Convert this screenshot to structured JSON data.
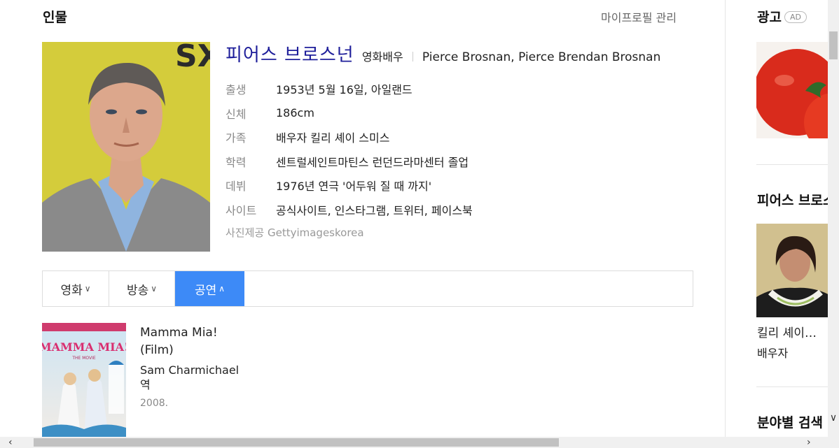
{
  "section": {
    "title": "인물",
    "my_profile_link": "마이프로필 관리"
  },
  "profile": {
    "name": "피어스 브로스넌",
    "job": "영화배우",
    "english_name": "Pierce Brosnan, Pierce Brendan Brosnan",
    "info": [
      {
        "label": "출생",
        "value": "1953년 5월 16일, 아일랜드"
      },
      {
        "label": "신체",
        "value": "186cm"
      },
      {
        "label": "가족",
        "value": "배우자 킬리 셰이 스미스"
      },
      {
        "label": "학력",
        "value": "센트럴세인트마틴스 런던드라마센터 졸업"
      },
      {
        "label": "데뷔",
        "value": "1976년 연극 '어두워 질 때 까지'"
      },
      {
        "label": "사이트",
        "value": "공식사이트, 인스타그램, 트위터, 페이스북"
      }
    ],
    "photo_credit": "사진제공 Gettyimageskorea",
    "photo_backdrop_text": "SX SW"
  },
  "tabs": [
    {
      "label": "영화",
      "chevron": "∨",
      "active": false
    },
    {
      "label": "방송",
      "chevron": "∨",
      "active": false
    },
    {
      "label": "공연",
      "chevron": "∧",
      "active": true
    }
  ],
  "works": [
    {
      "title": "Mamma Mia! (Film)",
      "role": "Sam Charmichael 역",
      "year": "2008.",
      "poster_text": "MAMMA MIA!",
      "poster_subtext": "THE MOVIE"
    }
  ],
  "sidebar": {
    "ad_title": "광고",
    "ad_badge": "AD",
    "related_title": "피어스 브로스넌",
    "related_person": {
      "name": "킬리 셰이…",
      "job": "배우자"
    },
    "category_search_title": "분야별 검색"
  },
  "scrollbars": {
    "left_arrow": "‹",
    "right_arrow": "›",
    "down_arrow": "∨"
  },
  "colors": {
    "name_blue": "#1e1e9a",
    "tab_active": "#3d8af7"
  }
}
